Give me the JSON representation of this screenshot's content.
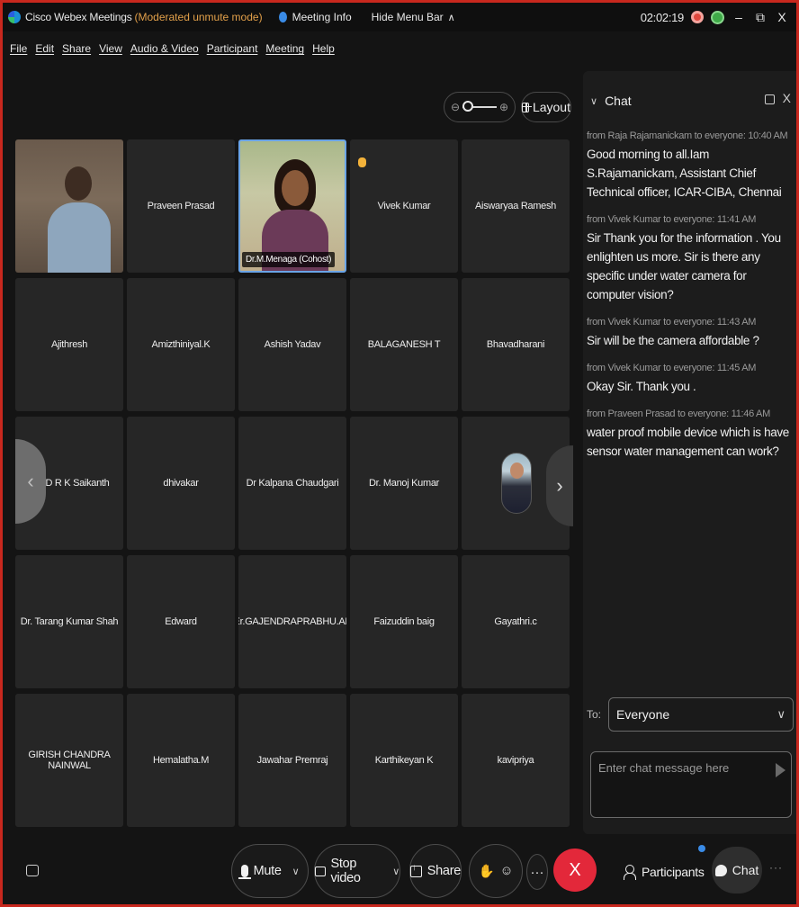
{
  "titlebar": {
    "app_name": "Cisco Webex Meetings",
    "mode": "(Moderated unmute mode)",
    "meeting_info": "Meeting Info",
    "hide_menu": "Hide Menu Bar",
    "hide_menu_icon": "chevron-up-icon",
    "clock": "02:02:19",
    "minimize": "–",
    "restore": "ꟷ",
    "close": "X"
  },
  "menu": {
    "items": [
      "File",
      "Edit",
      "Share",
      "View",
      "Audio & Video",
      "Participant",
      "Meeting",
      "Help"
    ]
  },
  "toolbar": {
    "zoom_out": "⊖",
    "zoom_in": "⊕",
    "layout_label": "Layout"
  },
  "tiles": [
    {
      "name": "",
      "type": "video-man"
    },
    {
      "name": "Praveen Prasad",
      "type": "name"
    },
    {
      "name": "Dr.M.Menaga (Cohost)",
      "type": "video-woman"
    },
    {
      "name": "Vivek Kumar",
      "type": "name",
      "hand_raised": true
    },
    {
      "name": "Aiswaryaa Ramesh",
      "type": "name"
    },
    {
      "name": "Ajithresh",
      "type": "name"
    },
    {
      "name": "Amizthiniyal.K",
      "type": "name"
    },
    {
      "name": "Ashish Yadav",
      "type": "name"
    },
    {
      "name": "BALAGANESH T",
      "type": "name"
    },
    {
      "name": "Bhavadharani",
      "type": "name"
    },
    {
      "name": "D R K Saikanth",
      "type": "name"
    },
    {
      "name": "dhivakar",
      "type": "name"
    },
    {
      "name": "Dr Kalpana Chaudgari",
      "type": "name"
    },
    {
      "name": "Dr. Manoj Kumar",
      "type": "name"
    },
    {
      "name": "",
      "type": "profile-pic"
    },
    {
      "name": "Dr. Tarang Kumar Shah",
      "type": "name"
    },
    {
      "name": "Edward",
      "type": "name"
    },
    {
      "name": "Er.GAJENDRAPRABHU.AP",
      "type": "name"
    },
    {
      "name": "Faizuddin baig",
      "type": "name"
    },
    {
      "name": "Gayathri.c",
      "type": "name"
    },
    {
      "name": "GIRISH CHANDRA NAINWAL",
      "type": "name"
    },
    {
      "name": "Hemalatha.M",
      "type": "name"
    },
    {
      "name": "Jawahar Premraj",
      "type": "name"
    },
    {
      "name": "Karthikeyan K",
      "type": "name"
    },
    {
      "name": "kavipriya",
      "type": "name"
    }
  ],
  "nav": {
    "prev": "‹",
    "next": "›"
  },
  "chat": {
    "title": "Chat",
    "collapse": "∨",
    "close": "X",
    "messages": [
      {
        "meta": "from Raja Rajamanickam to everyone:   10:40 AM",
        "text": "Good morning to all.Iam S.Rajamanickam, Assistant Chief Technical officer, ICAR-CIBA, Chennai"
      },
      {
        "meta": "from Vivek Kumar to everyone:   11:41 AM",
        "text": "Sir Thank you for the information . You enlighten us more. Sir is there any specific under water camera for computer vision?"
      },
      {
        "meta": "from Vivek Kumar to everyone:   11:43 AM",
        "text": "Sir will be the camera affordable ?"
      },
      {
        "meta": "from Vivek Kumar to everyone:   11:45 AM",
        "text": "Okay Sir. Thank you ."
      },
      {
        "meta": "from Praveen Prasad to everyone:   11:46 AM",
        "text": "water proof mobile device which is have sensor water management  can work?"
      }
    ],
    "to_label": "To:",
    "to_value": "Everyone",
    "input_placeholder": "Enter chat message here"
  },
  "controls": {
    "mute": "Mute",
    "stop_video": "Stop video",
    "share": "Share",
    "participants": "Participants",
    "chat": "Chat",
    "end": "X",
    "more": "···",
    "more_right": "···",
    "reactions": "☺",
    "hand": "✋"
  },
  "colors": {
    "mode_text": "#e2a04a",
    "end_button": "#e3283a",
    "active_border": "#6aa4e6",
    "frame_border": "#c8281e"
  }
}
